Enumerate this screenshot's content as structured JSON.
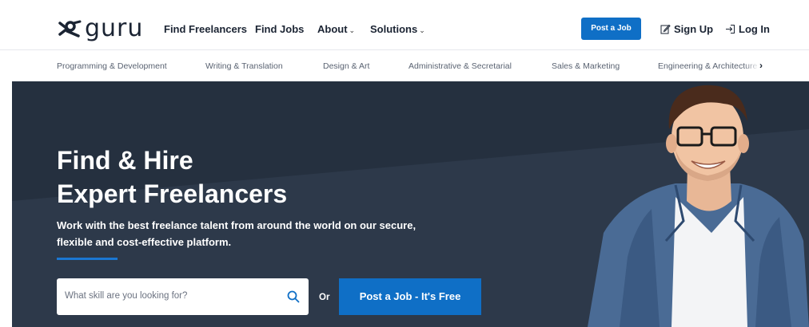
{
  "header": {
    "logo_text": "guru",
    "nav": [
      {
        "label": "Find Freelancers",
        "has_dropdown": false
      },
      {
        "label": "Find Jobs",
        "has_dropdown": false
      },
      {
        "label": "About",
        "has_dropdown": true
      },
      {
        "label": "Solutions",
        "has_dropdown": true
      }
    ],
    "post_job_label": "Post a Job",
    "sign_up_label": "Sign Up",
    "log_in_label": "Log In"
  },
  "categories": [
    "Programming & Development",
    "Writing & Translation",
    "Design & Art",
    "Administrative & Secretarial",
    "Sales & Marketing",
    "Engineering & Architecture"
  ],
  "hero": {
    "title_line1": "Find & Hire",
    "title_line2": "Expert Freelancers",
    "subtitle_line1": "Work with the best freelance talent from around the world on our secure,",
    "subtitle_line2": "flexible and cost-effective platform.",
    "search_placeholder": "What skill are you looking for?",
    "or_label": "Or",
    "cta_label": "Post a Job - It's Free"
  },
  "colors": {
    "brand_blue": "#0f6fc6",
    "hero_bg": "#2d394a",
    "text_dark": "#1b2433"
  },
  "icons": {
    "logo": "guru-logo-icon",
    "sign_up": "edit-icon",
    "log_in": "login-icon",
    "search": "search-icon",
    "next": "chevron-right-icon"
  }
}
